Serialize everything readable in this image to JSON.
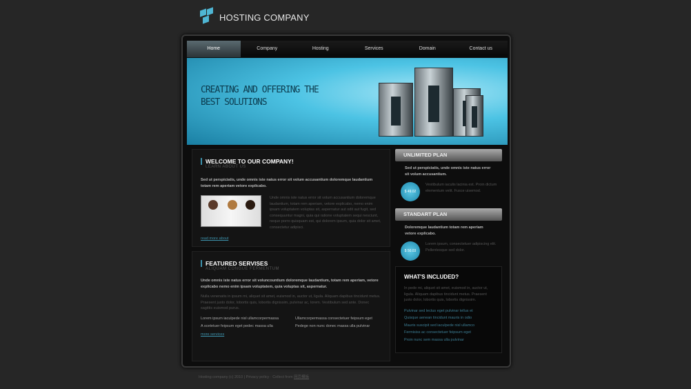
{
  "header": {
    "logo_icon": "cubes-icon",
    "title": "HOSTING COMPANY"
  },
  "nav": {
    "items": [
      "Home",
      "Company",
      "Hosting",
      "Services",
      "Domain",
      "Contact us"
    ],
    "active": "Home"
  },
  "banner": {
    "line1": "CREATING AND OFFERING THE",
    "line2": "BEST SOLUTIONS"
  },
  "welcome": {
    "title": "WELCOME TO OUR COMPANY!",
    "subtitle": "LEARN ABOUT US",
    "lead": "Sed ut perspiciatis, unde omnis iste natus error sit volum accusantium doloremque laudantium totam rem aperiam vetore explicabo.",
    "body": "Unde omnis iste natus error sit volum accusantium doloremque laudantium, totam rem aperiam, vetore explicabo, nemo enim ipsam voluptatem voluptas sit, aspernatur aut odit aut fugit, sed consequuntur magni, quia qui ratione voluptatem sequi nesciunt, neque porro quisquam est, qui dolorem ipsum, quia dolor sit amet, consectetur adipisci.",
    "link": "read more about"
  },
  "featured": {
    "title": "FEATURED SERVISES",
    "subtitle": "ALIQUAM CONGUE FERMENTUM",
    "lead": "Unde omnis iste natus error sit voluncountium doloremque laudantium, totam rem aperiam, vetore explicabo nemo enim ipsam voluptatem, quia voluptas sit, aspernatur.",
    "body": "Nulla venenatis in ipsum mi, aliquet sit amet, euismod in, auctor ut, ligula. Aliquam dapibus tincidunt metus. Praesent justo dolor, lobortis quis, lobortis dignissim, pulvinar ac, lorem. Vestibulum sed ante. Donec sagittis euismod purus.",
    "items": [
      "Lorem ipsum iaculpede nisl ullamcorpermassa",
      "Ullamcorpermassa consectetuer feipsum eget",
      "A scetetuer feipsum eget pedec massa ulla",
      "Pedege non nunc donec massa ulla pulvinar"
    ],
    "link": "more services"
  },
  "plans": [
    {
      "title": "UNLIMITED PLAN",
      "lead": "Sed ut perspiciatis, unde omnis iste natus error sit volum accusantium.",
      "price": "$ 49.02",
      "text": "Vestibulum iaculis lacinia est. Proin dictum elementum velit. Fusce uisemod."
    },
    {
      "title": "STANDART PLAN",
      "lead": "Doloremque laudantium totam rem aperiam vetore explicabo.",
      "price": "$ 50.03",
      "text": "Lorem ipsum, consectetuer adipiscing elit. Pellentesque sed dolor."
    }
  ],
  "included": {
    "title": "WHAT'S INCLUDED?",
    "body": "In pede mi, aliquet sit amet, euismod in, auctor ut, ligula. Aliquam dapibus tincidunt metus. Praesent justo dolor, lobortis quis, lobortis dignissim.",
    "items": [
      "Pulvinar sed lectus eget pulvinar tellus et",
      "Quisque aenean tincidunt mauris in odio",
      "Mauris suscipit sed iaculpede nisl ullamco",
      "Fermisiss ac consectetuer feipsum eget",
      "Proin nunc sem massa ulla pulvinar"
    ]
  },
  "footer": {
    "text": "Hosting company (c) 2010 | Privacy policy · Collect from",
    "link": "网页模板"
  },
  "colors": {
    "accent": "#3d93ad",
    "background": "#262626",
    "banner": "#4cc3e4"
  }
}
